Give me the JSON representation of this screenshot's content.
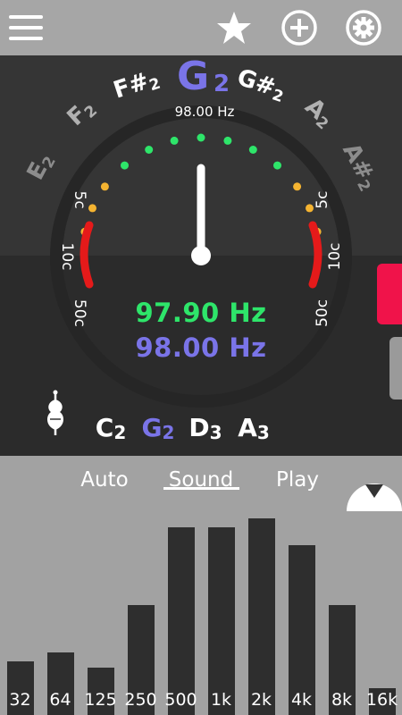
{
  "toolbar": {
    "menu_icon": "menu-icon",
    "favorite_icon": "star-icon",
    "add_icon": "plus-circle-icon",
    "settings_icon": "gear-icon"
  },
  "tuner": {
    "current_note": "G",
    "current_octave": "2",
    "reference_frequency": "98.00 Hz",
    "notes": [
      {
        "name": "E",
        "octave": "2"
      },
      {
        "name": "F",
        "octave": "2"
      },
      {
        "name": "F#",
        "octave": "2"
      },
      {
        "name": "G",
        "octave": "2"
      },
      {
        "name": "G#",
        "octave": "2"
      },
      {
        "name": "A",
        "octave": "2"
      },
      {
        "name": "A#",
        "octave": "2"
      }
    ],
    "scale_labels_left": [
      "5c",
      "10c",
      "50c"
    ],
    "scale_labels_right": [
      "5c",
      "10c",
      "50c"
    ],
    "needle_cents": 0,
    "measured_frequency": "97.90 Hz",
    "target_frequency": "98.00 Hz",
    "instrument_icon": "violin-icon",
    "strings": [
      {
        "name": "C",
        "octave": "2"
      },
      {
        "name": "G",
        "octave": "2",
        "active": true
      },
      {
        "name": "D",
        "octave": "3"
      },
      {
        "name": "A",
        "octave": "3"
      }
    ],
    "colors": {
      "in_tune": "#2ee56a",
      "close": "#f5b431",
      "far": "#e51a1a",
      "accent": "#7a74e8",
      "side_tab": "#f0134a"
    }
  },
  "modes": {
    "auto": "Auto",
    "sound": "Sound",
    "play": "Play",
    "selected": "Sound"
  },
  "spectrum": {
    "collapse_icon": "triangle-down-icon",
    "bands": [
      {
        "label": "32",
        "level": 0.24
      },
      {
        "label": "64",
        "level": 0.28
      },
      {
        "label": "125",
        "level": 0.21
      },
      {
        "label": "250",
        "level": 0.49
      },
      {
        "label": "500",
        "level": 0.84
      },
      {
        "label": "1k",
        "level": 0.84
      },
      {
        "label": "2k",
        "level": 0.88
      },
      {
        "label": "4k",
        "level": 0.76
      },
      {
        "label": "8k",
        "level": 0.49
      },
      {
        "label": "16k",
        "level": 0.12
      }
    ]
  }
}
